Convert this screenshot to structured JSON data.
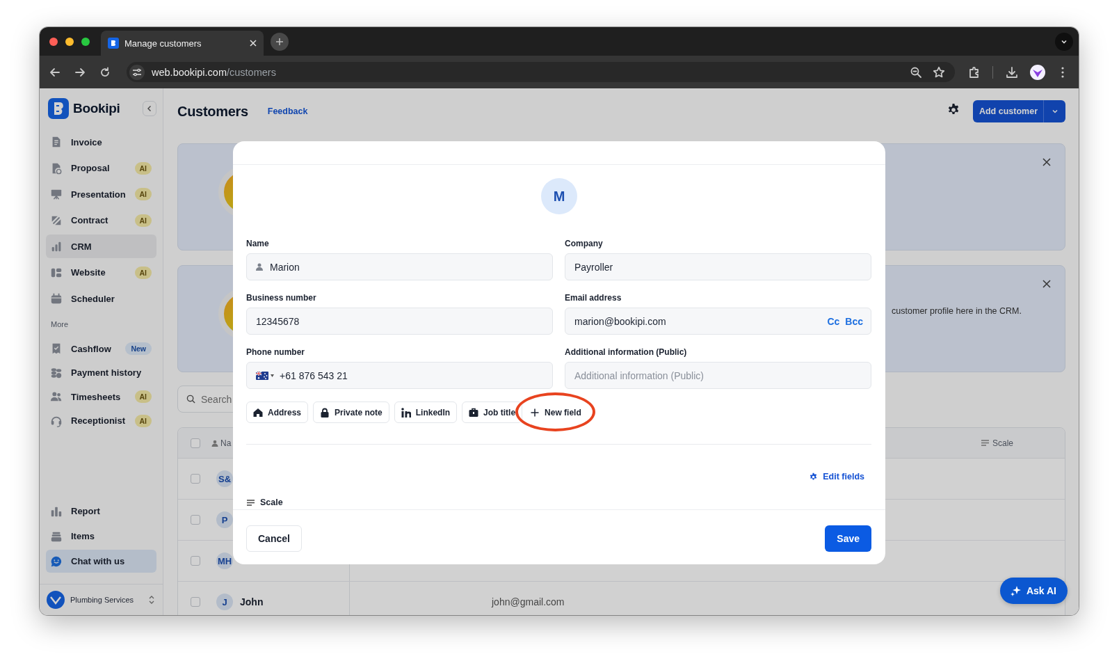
{
  "browser": {
    "tab_title": "Manage customers",
    "url_host": "web.bookipi.com",
    "url_path": "/customers"
  },
  "sidebar": {
    "brand": "Bookipi",
    "items": [
      {
        "label": "Invoice",
        "selected": false
      },
      {
        "label": "Proposal",
        "selected": false,
        "badge": {
          "text": "AI",
          "kind": "ai"
        }
      },
      {
        "label": "Presentation",
        "selected": false,
        "badge": {
          "text": "AI",
          "kind": "ai"
        }
      },
      {
        "label": "Contract",
        "selected": false,
        "badge": {
          "text": "AI",
          "kind": "ai"
        }
      },
      {
        "label": "CRM",
        "selected": true
      },
      {
        "label": "Website",
        "selected": false,
        "badge": {
          "text": "AI",
          "kind": "ai"
        }
      },
      {
        "label": "Scheduler",
        "selected": false
      }
    ],
    "more_label": "More",
    "more_items": [
      {
        "label": "Cashflow",
        "selected": false,
        "badge": {
          "text": "New",
          "kind": "new"
        }
      },
      {
        "label": "Payment history",
        "selected": false
      },
      {
        "label": "Timesheets",
        "selected": false,
        "badge": {
          "text": "AI",
          "kind": "ai"
        }
      },
      {
        "label": "Receptionist",
        "selected": false,
        "badge": {
          "text": "AI",
          "kind": "ai"
        }
      }
    ],
    "bottom_items": [
      {
        "label": "Report",
        "selected": false
      },
      {
        "label": "Items",
        "selected": false
      }
    ],
    "chat_item": {
      "label": "Chat with us"
    },
    "workspace": {
      "name": "Plumbing Services"
    }
  },
  "page": {
    "title": "Customers",
    "feedback_link": "Feedback",
    "add_button": "Add customer"
  },
  "banners": [
    {
      "dismissible": true
    },
    {
      "text": "customer profile here in the CRM.",
      "dismissible": true
    }
  ],
  "search": {
    "placeholder": "Search"
  },
  "table": {
    "header_checked": false,
    "columns": [
      {
        "label": "Na"
      },
      {
        "label": "Scale"
      }
    ],
    "rows": [
      {
        "initials": "S&",
        "checked": false
      },
      {
        "initials": "P",
        "checked": false
      },
      {
        "initials": "MH",
        "checked": false
      },
      {
        "initials": "J",
        "name": "John",
        "email": "john@gmail.com",
        "checked": false
      }
    ]
  },
  "modal": {
    "avatar": "M",
    "fields": [
      {
        "label": "Name",
        "value": "Marion",
        "kind": "person"
      },
      {
        "label": "Company",
        "value": "Payroller",
        "kind": "text"
      },
      {
        "label": "Business number",
        "value": "12345678",
        "kind": "text"
      },
      {
        "label": "Email address",
        "value": "marion@bookipi.com",
        "kind": "email",
        "extras": [
          "Cc",
          "Bcc"
        ]
      },
      {
        "label": "Phone number",
        "value": "+61 876 543 21",
        "kind": "phone"
      },
      {
        "label": "Additional information (Public)",
        "placeholder": "Additional information (Public)",
        "kind": "text"
      }
    ],
    "chips": [
      {
        "label": "Address",
        "kind": "preset",
        "highlighted": false
      },
      {
        "label": "Private note",
        "kind": "preset",
        "highlighted": false
      },
      {
        "label": "LinkedIn",
        "kind": "preset",
        "highlighted": false
      },
      {
        "label": "Job title",
        "kind": "preset",
        "highlighted": false
      },
      {
        "label": "New field",
        "kind": "add",
        "highlighted": true
      }
    ],
    "edit_fields_link": "Edit fields",
    "custom_fields": [
      {
        "label": "Scale"
      }
    ],
    "cancel": "Cancel",
    "save": "Save"
  },
  "ask_ai": "Ask AI"
}
